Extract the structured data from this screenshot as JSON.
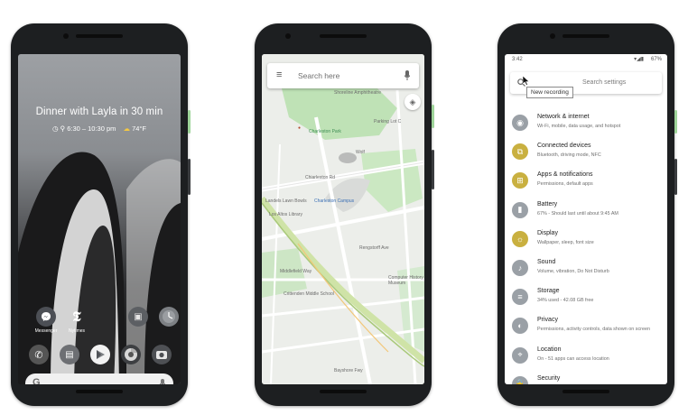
{
  "phone1": {
    "glance_title": "Dinner with Layla in 30 min",
    "glance_time": "6:30 – 10:30 pm",
    "glance_weather": "74°F",
    "apps_row1": [
      {
        "label": "Messenger",
        "icon": "messenger-icon"
      },
      {
        "label": "Nytimes",
        "icon": "nytimes-icon"
      },
      {
        "label": "",
        "icon": "briefcase-icon"
      },
      {
        "label": "",
        "icon": "clock-icon"
      }
    ],
    "dock": [
      {
        "icon": "phone-icon"
      },
      {
        "icon": "messages-icon"
      },
      {
        "icon": "play-store-icon"
      },
      {
        "icon": "chrome-icon"
      },
      {
        "icon": "camera-icon"
      }
    ],
    "search_logo": "G"
  },
  "phone2": {
    "search_placeholder": "Search here",
    "labels": {
      "p1": "Shoreline Amphitheatre",
      "p2": "Parking Lot C",
      "p3": "Charleston Park",
      "p4": "Chiarleston Rd",
      "p5": "Charleston Campus",
      "p6": "Los Altos Library",
      "p7": "Middlefield Way",
      "p8": "Crittenden Middle School",
      "p9": "Computer History Museum",
      "p10": "Rengstorff Ave",
      "p11": "Bayshore Fwy",
      "p12": "Wolf",
      "p13": "Landels Lawn Bowls"
    }
  },
  "phone3": {
    "status_time": "3:42",
    "status_battery": "67%",
    "search_placeholder": "Search settings",
    "tooltip": "New recording",
    "items": [
      {
        "title": "Network & internet",
        "sub": "Wi-Fi, mobile, data usage, and hotspot",
        "icon": "wifi-icon",
        "color": "#9aa0a6"
      },
      {
        "title": "Connected devices",
        "sub": "Bluetooth, driving mode, NFC",
        "icon": "devices-icon",
        "color": "#c9b040"
      },
      {
        "title": "Apps & notifications",
        "sub": "Permissions, default apps",
        "icon": "apps-icon",
        "color": "#c9b040"
      },
      {
        "title": "Battery",
        "sub": "67% - Should last until about 9:45 AM",
        "icon": "battery-icon",
        "color": "#9aa0a6"
      },
      {
        "title": "Display",
        "sub": "Wallpaper, sleep, font size",
        "icon": "display-icon",
        "color": "#c9b040"
      },
      {
        "title": "Sound",
        "sub": "Volume, vibration, Do Not Disturb",
        "icon": "sound-icon",
        "color": "#9aa0a6"
      },
      {
        "title": "Storage",
        "sub": "34% used - 42.08 GB free",
        "icon": "storage-icon",
        "color": "#9aa0a6"
      },
      {
        "title": "Privacy",
        "sub": "Permissions, activity controls, data shown on screen",
        "icon": "privacy-icon",
        "color": "#9aa0a6"
      },
      {
        "title": "Location",
        "sub": "On - 51 apps can access location",
        "icon": "location-icon",
        "color": "#9aa0a6"
      },
      {
        "title": "Security",
        "sub": "",
        "icon": "security-icon",
        "color": "#9aa0a6"
      }
    ]
  }
}
